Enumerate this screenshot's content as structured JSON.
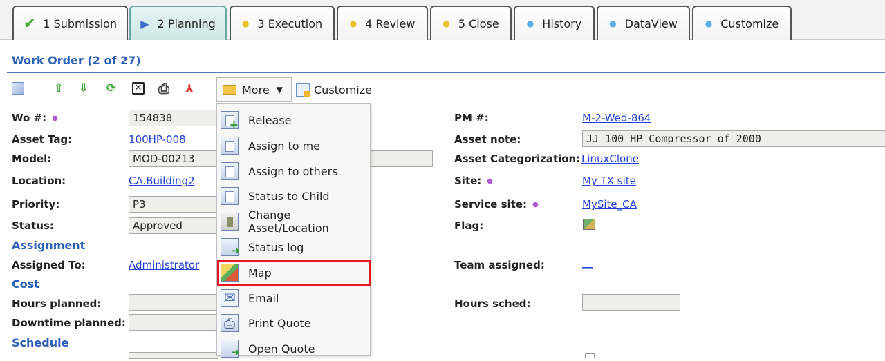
{
  "tabs": [
    {
      "label": "1 Submission",
      "icon": "check-icon"
    },
    {
      "label": "2 Planning",
      "icon": "play-icon"
    },
    {
      "label": "3 Execution",
      "icon": "yellow-dot-icon"
    },
    {
      "label": "4 Review",
      "icon": "yellow-dot-icon"
    },
    {
      "label": "5 Close",
      "icon": "yellow-dot-icon"
    },
    {
      "label": "History",
      "icon": "blue-dot-icon"
    },
    {
      "label": "DataView",
      "icon": "blue-dot-icon"
    },
    {
      "label": "Customize",
      "icon": "blue-dot-icon"
    }
  ],
  "active_tab": "2 Planning",
  "header": {
    "title": "Work Order (2 of 27)"
  },
  "toolbar": {
    "icons": [
      "edit-icon",
      "move-up-icon",
      "move-down-icon",
      "refresh-icon",
      "delete-icon",
      "print-icon",
      "pdf-icon"
    ],
    "more_label": "More",
    "customize_label": "Customize"
  },
  "more_menu": {
    "items": [
      {
        "label": "Release",
        "icon": "release-icon"
      },
      {
        "label": "Assign to me",
        "icon": "assign-me-icon"
      },
      {
        "label": "Assign to others",
        "icon": "assign-others-icon"
      },
      {
        "label": "Status to Child",
        "icon": "status-child-icon"
      },
      {
        "label": "Change Asset/Location",
        "icon": "building-icon"
      },
      {
        "label": "Status log",
        "icon": "status-log-icon"
      },
      {
        "label": "Map",
        "icon": "map-icon",
        "highlighted": true
      },
      {
        "label": "Email",
        "icon": "email-icon"
      },
      {
        "label": "Print Quote",
        "icon": "print-icon"
      },
      {
        "label": "Open Quote",
        "icon": "open-quote-icon"
      }
    ]
  },
  "form": {
    "wo_label": "Wo #:",
    "wo_value": "154838",
    "asset_tag_label": "Asset Tag:",
    "asset_tag_value": "100HP-008",
    "model_label": "Model:",
    "model_value": "MOD-00213",
    "location_label": "Location:",
    "location_value": "CA.Building2",
    "priority_label": "Priority:",
    "priority_value": "P3",
    "status_label": "Status:",
    "status_value": "Approved",
    "assignment_section": "Assignment",
    "assigned_to_label": "Assigned To:",
    "assigned_to_value": "Administrator",
    "cost_section": "Cost",
    "hours_planned_label": "Hours planned:",
    "hours_planned_value": "",
    "downtime_planned_label": "Downtime planned:",
    "downtime_planned_value": "",
    "schedule_section": "Schedule",
    "pm_label": "PM #:",
    "pm_value": "M-2-Wed-864",
    "asset_note_label": "Asset note:",
    "asset_note_value": "JJ 100 HP Compressor of 2000",
    "asset_cat_label": "Asset Categorization:",
    "asset_cat_value": "LinuxClone",
    "site_label": "Site:",
    "site_value": "My TX site",
    "service_site_label": "Service site:",
    "service_site_value": "MySite_CA",
    "flag_label": "Flag:",
    "team_label": "Team assigned:",
    "team_value": "__",
    "hours_sched_label": "Hours sched:",
    "hours_sched_value": ""
  },
  "colors": {
    "accent": "#2a5fb8",
    "link": "#1f3fd6",
    "highlight": "#e5161f",
    "required_dot": "#b05ad6"
  }
}
